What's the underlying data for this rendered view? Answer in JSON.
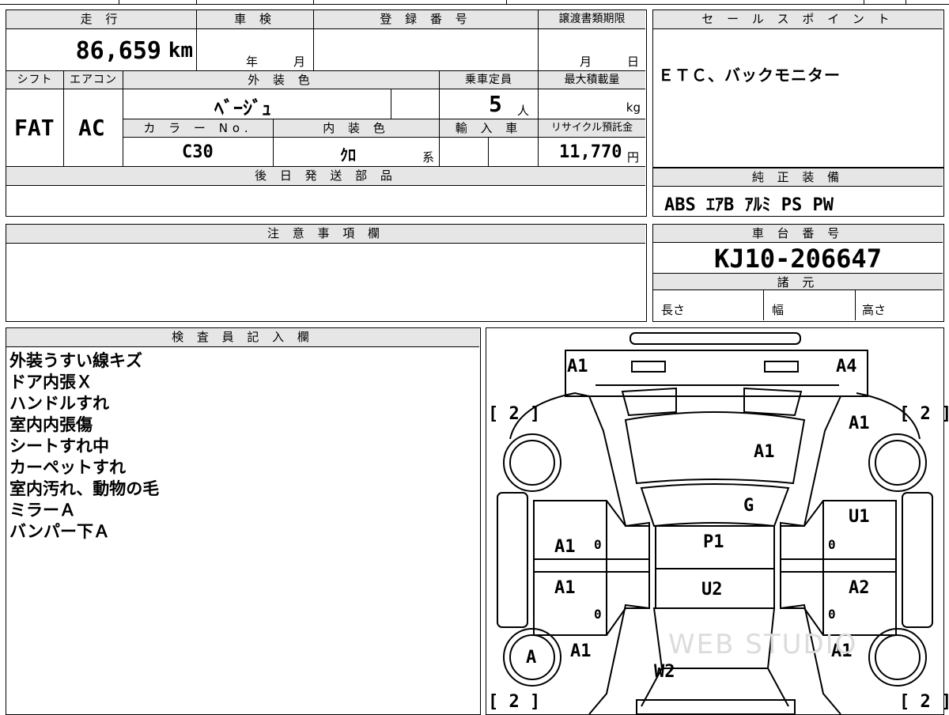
{
  "vehicle": {
    "mileage_label": "走 行",
    "mileage": "86,659",
    "mileage_unit": "km",
    "inspection_label": "車 検",
    "inspection_year": "年",
    "inspection_month": "月",
    "reg_label": "登 録 番 号",
    "transfer_label": "譲渡書類期限",
    "transfer_month": "月",
    "transfer_day": "日",
    "shift_label": "シフト",
    "shift": "FAT",
    "ac_label": "エアコン",
    "ac": "AC",
    "ext_color_label": "外 装 色",
    "ext_color": "ﾍﾞｰｼﾞｭ",
    "capacity_label": "乗車定員",
    "capacity": "5",
    "capacity_unit": "人",
    "max_load_label": "最大積載量",
    "max_load_unit": "kg",
    "color_no_label": "カ ラ ー No.",
    "color_no": "C30",
    "int_color_label": "内 装 色",
    "int_color": "ｸﾛ",
    "int_color_unit": "系",
    "import_label": "輸 入 車",
    "recycle_label": "リサイクル預託金",
    "recycle": "11,770",
    "recycle_unit": "円",
    "later_parts_label": "後 日 発 送 部 品"
  },
  "sales": {
    "label": "セ ー ル ス ポ イ ン ト",
    "text": "ＥＴＣ、バックモニター"
  },
  "equipment": {
    "label": "純 正 装 備",
    "text": "ABS ｴｱB ｱﾙﾐ PS PW"
  },
  "notes": {
    "label": "注 意 事 項 欄"
  },
  "chassis": {
    "label": "車 台 番 号",
    "number": "KJ10-206647",
    "specs_label": "諸 元",
    "length": "長さ",
    "width": "幅",
    "height": "高さ"
  },
  "inspector": {
    "label": "検 査 員 記 入 欄",
    "lines": [
      "外装うすい線キズ",
      "ドア内張Ｘ",
      "ハンドルすれ",
      "室内内張傷",
      "シートすれ中",
      "カーペットすれ",
      "室内汚れ、動物の毛",
      "ミラーＡ",
      "バンパー下Ａ"
    ]
  },
  "diagram": {
    "front_left": "A1",
    "front_right": "A4",
    "tire_fl": "[ 2 ]",
    "tire_fr": "[ 2 ]",
    "tire_rl": "[ 2 ]",
    "tire_rr": "[ 2 ]",
    "fender_r": "A1",
    "hood": "A1",
    "glass": "G",
    "roof_upper": "P1",
    "roof_lower": "U2",
    "door_fl": "A1",
    "door_rl": "A1",
    "door_fr": "U1",
    "door_rr": "A2",
    "quarter_l": "A1",
    "quarter_r": "A1",
    "rear_glass": "W2",
    "wheel_rl": "A",
    "zero": "0",
    "watermark": "WEB STUDIO"
  }
}
